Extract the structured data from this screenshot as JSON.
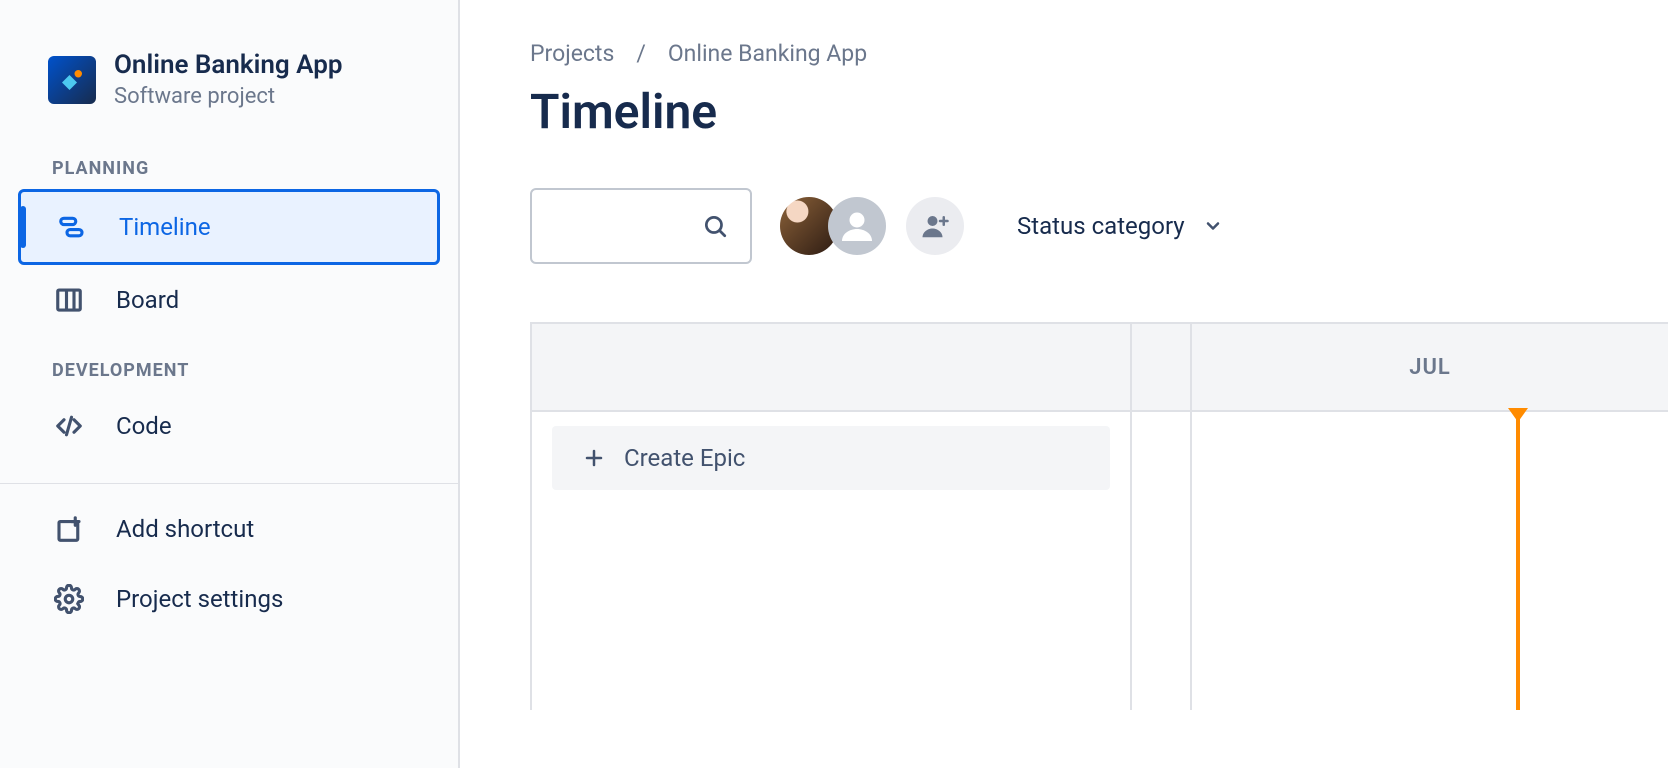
{
  "project": {
    "name": "Online Banking App",
    "type": "Software project"
  },
  "sidebar": {
    "sections": {
      "planning": {
        "label": "PLANNING"
      },
      "development": {
        "label": "DEVELOPMENT"
      }
    },
    "items": {
      "timeline": "Timeline",
      "board": "Board",
      "code": "Code",
      "add_shortcut": "Add shortcut",
      "project_settings": "Project settings"
    }
  },
  "breadcrumb": {
    "root": "Projects",
    "separator": "/",
    "current": "Online Banking App"
  },
  "page": {
    "title": "Timeline"
  },
  "toolbar": {
    "status_filter": "Status category"
  },
  "timeline": {
    "create_epic": "Create Epic",
    "months": [
      "JUL"
    ]
  }
}
